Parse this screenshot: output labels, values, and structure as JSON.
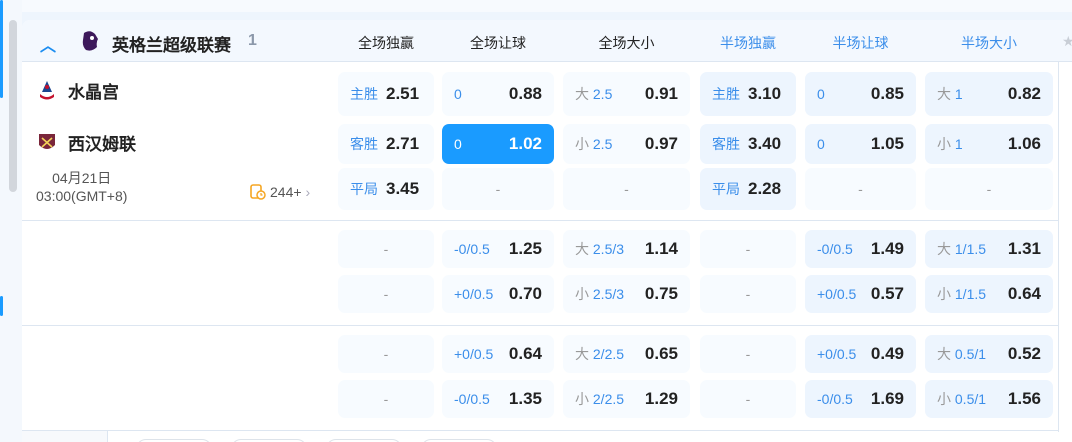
{
  "league": {
    "name": "英格兰超级联赛",
    "count": "1",
    "expanded": true
  },
  "columns": [
    {
      "label": "全场独赢",
      "highlight": false
    },
    {
      "label": "全场让球",
      "highlight": false
    },
    {
      "label": "全场大小",
      "highlight": false
    },
    {
      "label": "半场独赢",
      "highlight": true
    },
    {
      "label": "半场让球",
      "highlight": true
    },
    {
      "label": "半场大小",
      "highlight": true
    }
  ],
  "match": {
    "home": "水晶宫",
    "away": "西汉姆联",
    "date": "04月21日",
    "time": "03:00(GMT+8)",
    "more_count": "244+"
  },
  "colors": {
    "accent": "#1a9bff",
    "label_blue": "#3b8eea"
  },
  "groups": [
    {
      "rows": [
        [
          {
            "k": "x12",
            "lab": "主胜",
            "odds": "2.51"
          },
          {
            "k": "hc",
            "lab": "0",
            "odds": "0.88"
          },
          {
            "k": "ou",
            "pre": "大",
            "lab": "2.5",
            "odds": "0.91"
          },
          {
            "k": "x12",
            "lab": "主胜",
            "odds": "3.10"
          },
          {
            "k": "hc",
            "lab": "0",
            "odds": "0.85"
          },
          {
            "k": "ou",
            "pre": "大",
            "lab": "1",
            "odds": "0.82"
          }
        ],
        [
          {
            "k": "x12",
            "lab": "客胜",
            "odds": "2.71"
          },
          {
            "k": "hc",
            "lab": "0",
            "odds": "1.02",
            "selected": true
          },
          {
            "k": "ou",
            "pre": "小",
            "lab": "2.5",
            "odds": "0.97"
          },
          {
            "k": "x12",
            "lab": "客胜",
            "odds": "3.40"
          },
          {
            "k": "hc",
            "lab": "0",
            "odds": "1.05"
          },
          {
            "k": "ou",
            "pre": "小",
            "lab": "1",
            "odds": "1.06"
          }
        ],
        [
          {
            "k": "x12",
            "lab": "平局",
            "odds": "3.45"
          },
          {
            "k": "dash",
            "lab": "-"
          },
          {
            "k": "dash",
            "lab": "-"
          },
          {
            "k": "x12",
            "lab": "平局",
            "odds": "2.28"
          },
          {
            "k": "dash",
            "lab": "-"
          },
          {
            "k": "dash",
            "lab": "-"
          }
        ]
      ]
    },
    {
      "rows": [
        [
          {
            "k": "dash",
            "lab": "-"
          },
          {
            "k": "hc",
            "lab": "-0/0.5",
            "odds": "1.25"
          },
          {
            "k": "ou",
            "pre": "大",
            "lab": "2.5/3",
            "odds": "1.14"
          },
          {
            "k": "dash",
            "lab": "-"
          },
          {
            "k": "hc",
            "lab": "-0/0.5",
            "odds": "1.49"
          },
          {
            "k": "ou",
            "pre": "大",
            "lab": "1/1.5",
            "odds": "1.31"
          }
        ],
        [
          {
            "k": "dash",
            "lab": "-"
          },
          {
            "k": "hc",
            "lab": "+0/0.5",
            "odds": "0.70"
          },
          {
            "k": "ou",
            "pre": "小",
            "lab": "2.5/3",
            "odds": "0.75"
          },
          {
            "k": "dash",
            "lab": "-"
          },
          {
            "k": "hc",
            "lab": "+0/0.5",
            "odds": "0.57"
          },
          {
            "k": "ou",
            "pre": "小",
            "lab": "1/1.5",
            "odds": "0.64"
          }
        ]
      ]
    },
    {
      "rows": [
        [
          {
            "k": "dash",
            "lab": "-"
          },
          {
            "k": "hc",
            "lab": "+0/0.5",
            "odds": "0.64"
          },
          {
            "k": "ou",
            "pre": "大",
            "lab": "2/2.5",
            "odds": "0.65"
          },
          {
            "k": "dash",
            "lab": "-"
          },
          {
            "k": "hc",
            "lab": "+0/0.5",
            "odds": "0.49"
          },
          {
            "k": "ou",
            "pre": "大",
            "lab": "0.5/1",
            "odds": "0.52"
          }
        ],
        [
          {
            "k": "dash",
            "lab": "-"
          },
          {
            "k": "hc",
            "lab": "-0/0.5",
            "odds": "1.35"
          },
          {
            "k": "ou",
            "pre": "小",
            "lab": "2/2.5",
            "odds": "1.29"
          },
          {
            "k": "dash",
            "lab": "-"
          },
          {
            "k": "hc",
            "lab": "-0/0.5",
            "odds": "1.69"
          },
          {
            "k": "ou",
            "pre": "小",
            "lab": "0.5/1",
            "odds": "1.56"
          }
        ]
      ]
    }
  ]
}
